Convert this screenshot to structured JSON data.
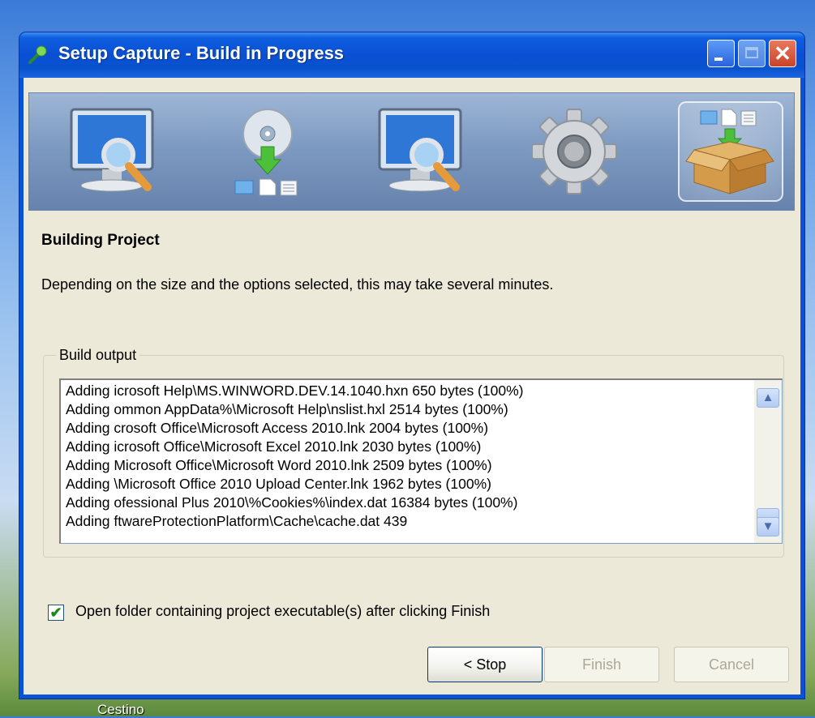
{
  "window": {
    "title": "Setup Capture - Build in Progress",
    "close_glyph": "✕"
  },
  "banner": {
    "steps": [
      {
        "icon": "monitor-magnifier-icon",
        "active": false
      },
      {
        "icon": "cd-install-files-icon",
        "active": false
      },
      {
        "icon": "monitor-magnifier-icon",
        "active": false
      },
      {
        "icon": "gear-icon",
        "active": false
      },
      {
        "icon": "package-box-icon",
        "active": true
      }
    ]
  },
  "section": {
    "title": "Building Project",
    "description": "Depending on the size and the options selected, this may take several minutes."
  },
  "build_output": {
    "legend": "Build output",
    "lines": [
      "Adding icrosoft Help\\MS.WINWORD.DEV.14.1040.hxn  650 bytes (100%)",
      "Adding ommon AppData%\\Microsoft Help\\nslist.hxl  2514 bytes (100%)",
      "Adding crosoft Office\\Microsoft Access 2010.lnk  2004 bytes (100%)",
      "Adding icrosoft Office\\Microsoft Excel 2010.lnk  2030 bytes (100%)",
      "Adding Microsoft Office\\Microsoft Word 2010.lnk  2509 bytes (100%)",
      "Adding \\Microsoft Office 2010 Upload Center.lnk  1962 bytes (100%)",
      "Adding ofessional Plus 2010\\%Cookies%\\index.dat  16384 bytes (100%)",
      "Adding ftwareProtectionPlatform\\Cache\\cache.dat  439"
    ],
    "scroll_up_glyph": "▲",
    "scroll_down_glyph": "▼"
  },
  "checkbox": {
    "checked": true,
    "glyph": "✔",
    "label": "Open folder containing project executable(s) after clicking Finish"
  },
  "buttons": {
    "stop": "< Stop",
    "finish": "Finish",
    "cancel": "Cancel"
  },
  "desktop": {
    "icon_label": "Cestino"
  },
  "colors": {
    "titlebar": "#0a4fd3",
    "client_bg": "#ece9d8",
    "close_button": "#c8432a"
  }
}
